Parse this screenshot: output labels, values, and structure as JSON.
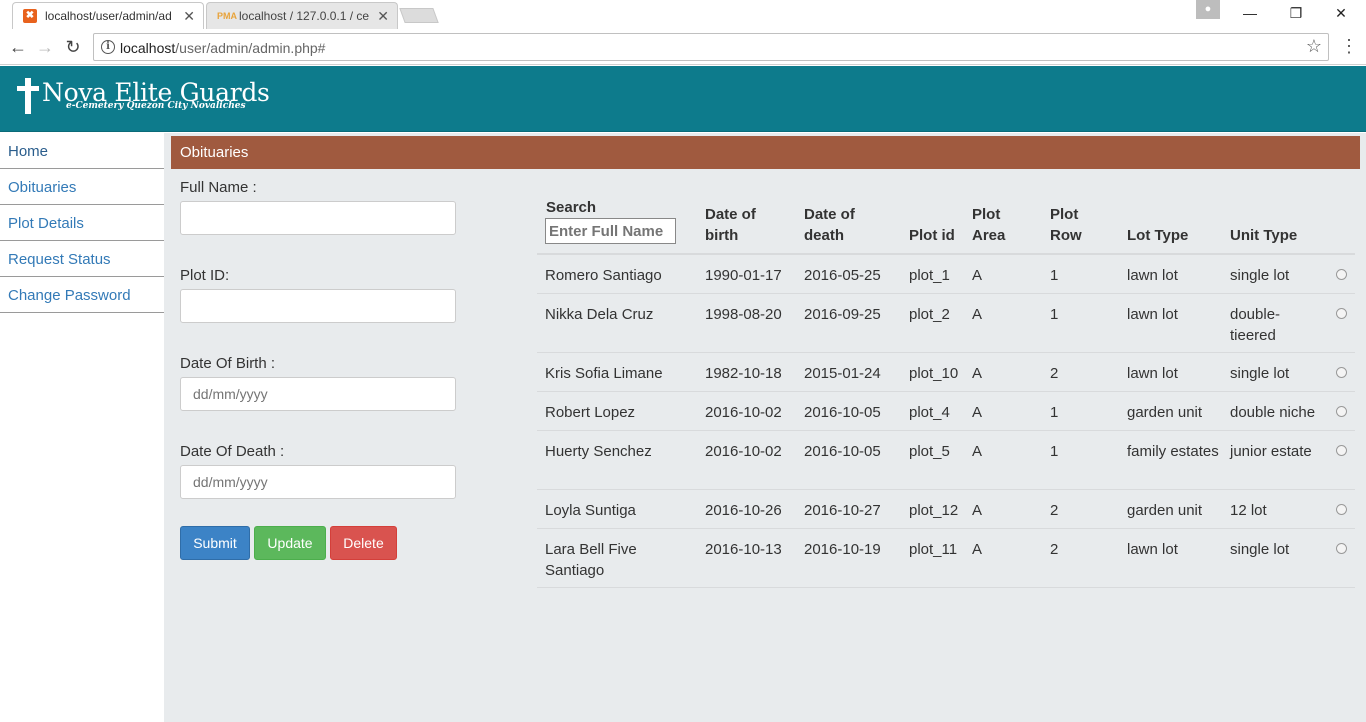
{
  "browser": {
    "tabs": [
      {
        "title": "localhost/user/admin/ad",
        "icon": "xampp-icon",
        "active": true
      },
      {
        "title": "localhost / 127.0.0.1 / ce",
        "icon": "pma-icon",
        "active": false
      }
    ],
    "address": {
      "host": "localhost",
      "path": "/user/admin/admin.php#"
    },
    "controls": {
      "minimize": "—",
      "restore": "❐",
      "close": "✕"
    }
  },
  "site": {
    "brand": "Nova Elite Guards",
    "subtitle": "e-Cemetery Quezon City Novaliches",
    "header_color": "#0d7b8c"
  },
  "sidebar": {
    "items": [
      {
        "label": "Home"
      },
      {
        "label": "Obituaries"
      },
      {
        "label": "Plot Details"
      },
      {
        "label": "Request Status"
      },
      {
        "label": "Change Password"
      }
    ]
  },
  "panel": {
    "title": "Obituaries",
    "color": "#a05a3f"
  },
  "form": {
    "full_name_label": "Full Name :",
    "full_name_value": "",
    "plot_id_label": "Plot ID:",
    "plot_id_value": "",
    "dob_label": "Date Of Birth :",
    "dob_placeholder": "dd/mm/yyyy",
    "dod_label": "Date Of Death :",
    "dod_placeholder": "dd/mm/yyyy",
    "submit_label": "Submit",
    "update_label": "Update",
    "delete_label": "Delete"
  },
  "table": {
    "search_label": "Search",
    "search_placeholder": "Enter Full Name",
    "headers": {
      "dob": [
        "Date of",
        "birth"
      ],
      "dod": [
        "Date of",
        "death"
      ],
      "plot_id": "Plot id",
      "plot_area": [
        "Plot",
        "Area"
      ],
      "plot_row": [
        "Plot",
        "Row"
      ],
      "lot_type": "Lot Type",
      "unit_type": "Unit Type"
    },
    "rows": [
      {
        "name": "Romero Santiago",
        "dob": "1990-01-17",
        "dod": "2016-05-25",
        "plot_id": "plot_1",
        "area": "A",
        "row": "1",
        "lot_type": "lawn lot",
        "unit_type": "single lot"
      },
      {
        "name": "Nikka Dela Cruz",
        "dob": "1998-08-20",
        "dod": "2016-09-25",
        "plot_id": "plot_2",
        "area": "A",
        "row": "1",
        "lot_type": "lawn lot",
        "unit_type": "double-tieered"
      },
      {
        "name": "Kris Sofia Limane",
        "dob": "1982-10-18",
        "dod": "2015-01-24",
        "plot_id": "plot_10",
        "area": "A",
        "row": "2",
        "lot_type": "lawn lot",
        "unit_type": "single lot"
      },
      {
        "name": "Robert Lopez",
        "dob": "2016-10-02",
        "dod": "2016-10-05",
        "plot_id": "plot_4",
        "area": "A",
        "row": "1",
        "lot_type": "garden unit",
        "unit_type": "double niche"
      },
      {
        "name": "Huerty Senchez",
        "dob": "2016-10-02",
        "dod": "2016-10-05",
        "plot_id": "plot_5",
        "area": "A",
        "row": "1",
        "lot_type": "family estates",
        "unit_type": "junior estate"
      },
      {
        "name": "Loyla Suntiga",
        "dob": "2016-10-26",
        "dod": "2016-10-27",
        "plot_id": "plot_12",
        "area": "A",
        "row": "2",
        "lot_type": "garden unit",
        "unit_type": "12 lot"
      },
      {
        "name": "Lara Bell Five Santiago",
        "dob": "2016-10-13",
        "dod": "2016-10-19",
        "plot_id": "plot_11",
        "area": "A",
        "row": "2",
        "lot_type": "lawn lot",
        "unit_type": "single lot"
      }
    ]
  }
}
